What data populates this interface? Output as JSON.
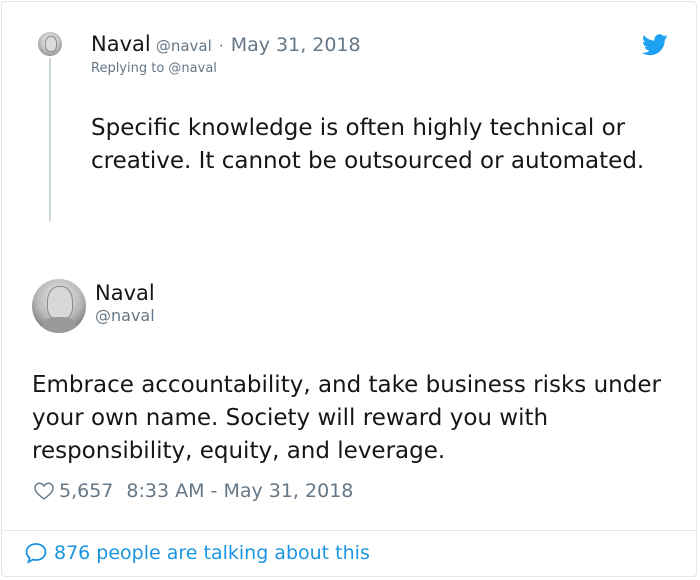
{
  "parent_tweet": {
    "name": "Naval",
    "handle": "@naval",
    "separator": "·",
    "date": "May 31, 2018",
    "replying_to": "Replying to @naval",
    "text": "Specific knowledge is often highly technical or creative. It cannot be outsourced or automated."
  },
  "main_tweet": {
    "name": "Naval",
    "handle": "@naval",
    "text": "Embrace accountability, and take business risks under your own name. Society will reward you with responsibility, equity, and leverage.",
    "likes": "5,657",
    "timestamp": "8:33 AM - May 31, 2018"
  },
  "footer": {
    "talking": "876 people are talking about this"
  },
  "colors": {
    "accent": "#1da1f2",
    "link": "#1b95e0",
    "muted": "#657786",
    "text": "#14171a",
    "border": "#e1e8ed"
  },
  "icons": {
    "brand": "twitter-bird-icon",
    "like": "heart-icon",
    "reply": "speech-bubble-icon"
  }
}
